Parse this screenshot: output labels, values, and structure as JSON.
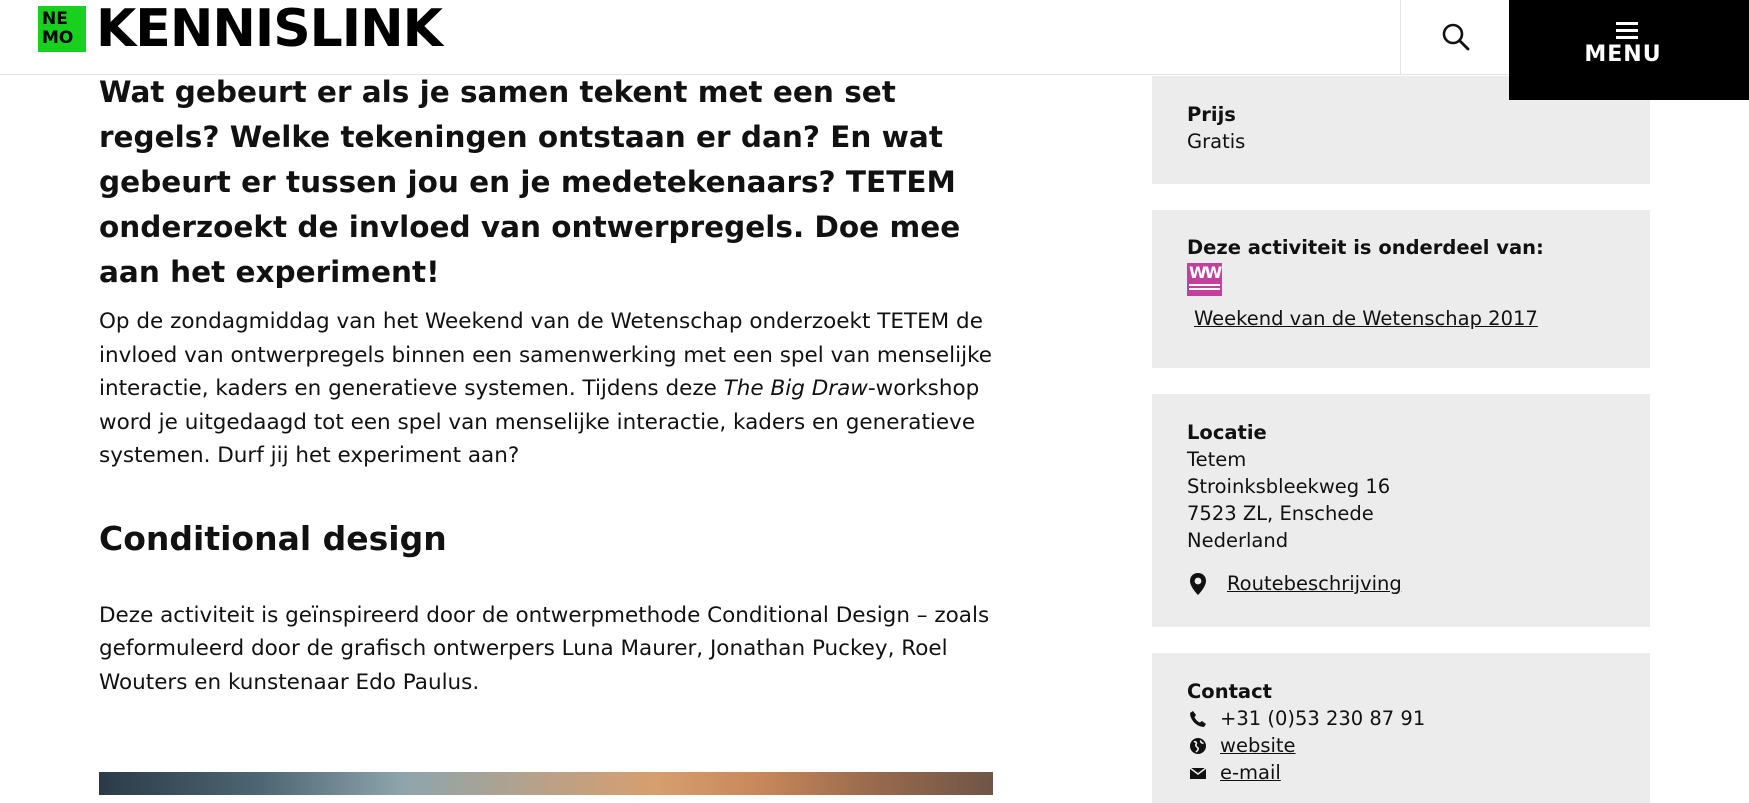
{
  "header": {
    "logo_mark": [
      "NE",
      "MO"
    ],
    "logo_text": "KENNISLINK",
    "menu_label": "MENU",
    "search_icon": "search-icon",
    "menu_icon": "hamburger-icon"
  },
  "article": {
    "intro": "Wat gebeurt er als je samen tekent met een set regels? Welke tekeningen ontstaan er dan? En wat gebeurt er tussen jou en je medetekenaars? TETEM onderzoekt de invloed van ontwerpregels. Doe mee aan het experiment!",
    "paragraph1_before": "Op de zondagmiddag van het Weekend van de Wetenschap onderzoekt TETEM de invloed van ontwerpregels binnen een samenwerking met een spel van menselijke interactie, kaders en generatieve systemen. Tijdens deze ",
    "paragraph1_italic": "The Big Draw",
    "paragraph1_after": "-workshop word je uitgedaagd tot een spel van menselijke interactie, kaders en generatieve systemen. Durf jij het experiment aan?",
    "heading2": "Conditional design",
    "paragraph2": "Deze activiteit is geïnspireerd door de ontwerpmethode Conditional Design – zoals geformuleerd door de grafisch ontwerpers Luna Maurer, Jonathan Puckey, Roel Wouters en kunstenaar Edo Paulus."
  },
  "sidebar": {
    "price": {
      "label": "Prijs",
      "value": "Gratis"
    },
    "part_of": {
      "label": "Deze activiteit is onderdeel van:",
      "link": "Weekend van de Wetenschap 2017",
      "logo_text": "WW"
    },
    "location": {
      "label": "Locatie",
      "lines": [
        "Tetem",
        "Stroinksbleekweg 16",
        "7523 ZL, Enschede",
        "Nederland"
      ],
      "route_link": "Routebeschrijving",
      "route_icon": "map-pin-icon"
    },
    "contact": {
      "label": "Contact",
      "phone": "+31 (0)53 230 87 91",
      "website": "website",
      "email": "e-mail",
      "phone_icon": "phone-icon",
      "globe_icon": "globe-icon",
      "mail_icon": "envelope-icon"
    }
  },
  "colors": {
    "logo_green": "#18d11e",
    "card_bg": "#ececec",
    "menu_bg": "#000000",
    "ww_pink": "#c2409c"
  }
}
